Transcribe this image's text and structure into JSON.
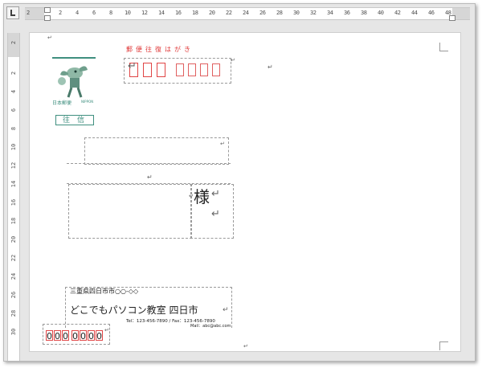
{
  "ruler": {
    "h_numbers": [
      "2",
      "2",
      "4",
      "6",
      "8",
      "10",
      "12",
      "14",
      "16",
      "18",
      "20",
      "22",
      "24",
      "26",
      "28",
      "30",
      "32",
      "34",
      "36",
      "38",
      "40",
      "42",
      "44",
      "46",
      "48"
    ],
    "v_numbers": [
      "2",
      "2",
      "4",
      "6",
      "8",
      "10",
      "12",
      "14",
      "16",
      "18",
      "20",
      "22",
      "24",
      "26",
      "28",
      "30"
    ]
  },
  "postcard": {
    "zip_label": "郵便往復はがき",
    "stamp_brand": "日本郵便",
    "stamp_brand_en": "NIPPON",
    "reply_label": "往　信",
    "honorific": "様",
    "sender_address": "三重県四日市市○○-◇◇",
    "sender_name": "どこでもパソコン教室 四日市",
    "sender_tel_fax": "Tel：123-456-7890 / Fax：123-456-7890",
    "sender_mail": "Mail：abc@abc.com",
    "sender_zip": [
      "0",
      "0",
      "0",
      "0",
      "0",
      "0",
      "0"
    ]
  },
  "colors": {
    "accent": "#e03a3a",
    "stamp": "#3f8f7f"
  },
  "marks": {
    "paragraph": "↵"
  }
}
